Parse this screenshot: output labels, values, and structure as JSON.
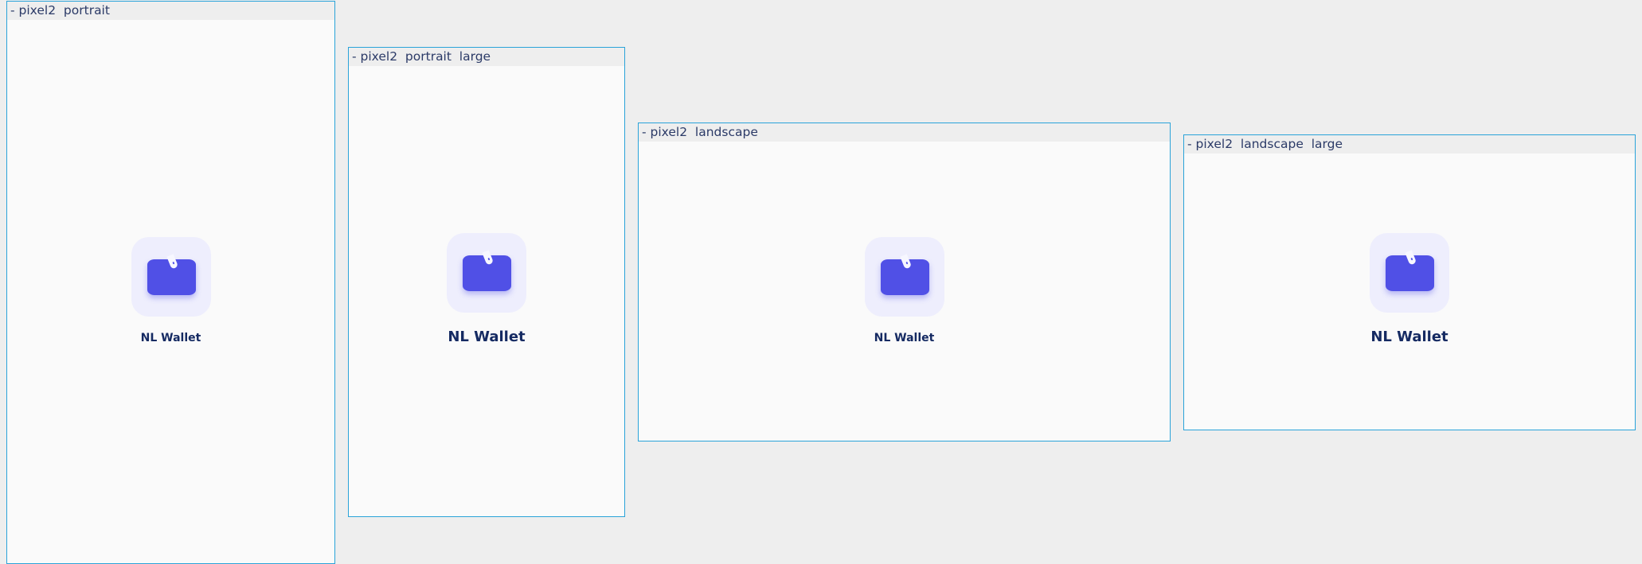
{
  "frames": [
    {
      "label": "- pixel2  portrait",
      "app": {
        "title": "NL Wallet"
      }
    },
    {
      "label": "- pixel2  portrait  large",
      "app": {
        "title": "NL Wallet"
      }
    },
    {
      "label": "- pixel2  landscape",
      "app": {
        "title": "NL Wallet"
      }
    },
    {
      "label": "- pixel2  landscape  large",
      "app": {
        "title": "NL Wallet"
      }
    }
  ],
  "colors": {
    "background": "#eeeeee",
    "frame_border": "#2aa3d9",
    "screen_background": "#fafafa",
    "icon_background": "#eeeefd",
    "wallet": "#5050e6",
    "title_text": "#152a62",
    "label_text": "#2b3a67"
  },
  "icons": {
    "app_icon": "wallet-icon"
  }
}
